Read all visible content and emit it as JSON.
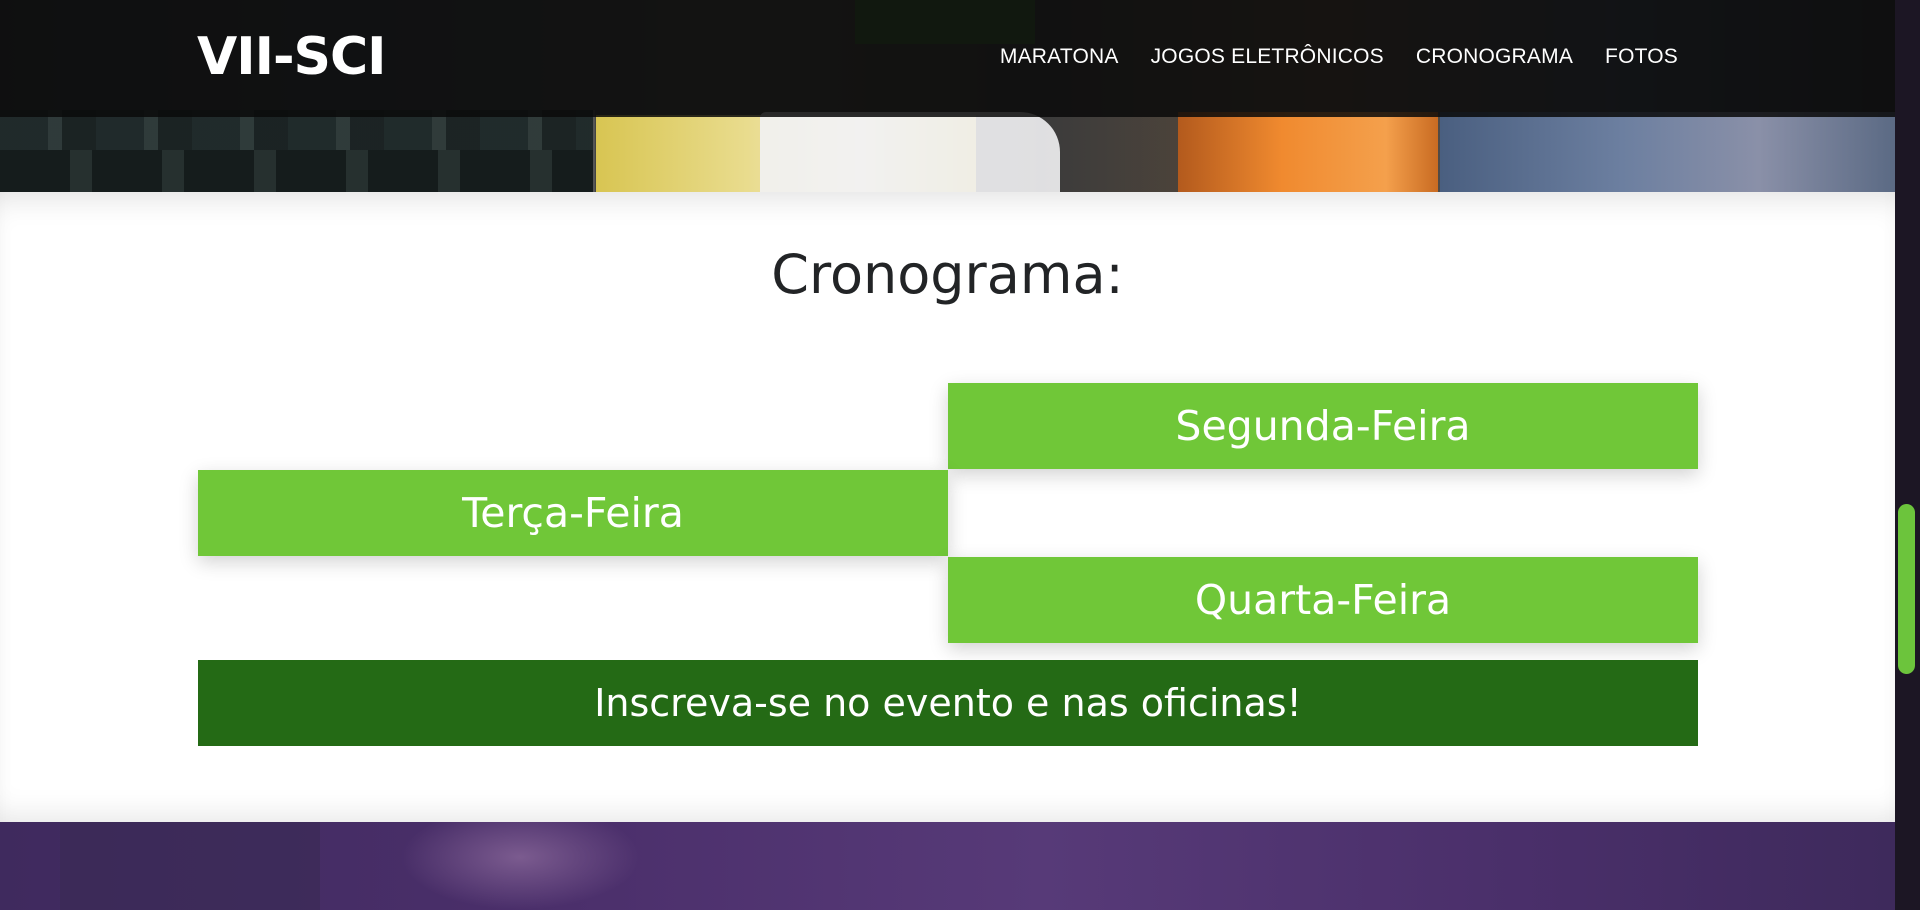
{
  "header": {
    "logo": "VII-SCI",
    "nav": [
      {
        "label": "MARATONA"
      },
      {
        "label": "JOGOS ELETRÔNICOS"
      },
      {
        "label": "CRONOGRAMA"
      },
      {
        "label": "FOTOS"
      }
    ]
  },
  "schedule": {
    "title": "Cronograma:",
    "days": [
      {
        "label": "Segunda-Feira"
      },
      {
        "label": "Terça-Feira"
      },
      {
        "label": "Quarta-Feira"
      }
    ],
    "signup_label": "Inscreva-se no evento e nas oficinas!"
  },
  "colors": {
    "day_green": "#70c738",
    "signup_green": "#246a15",
    "scroll_thumb": "#6cc43c",
    "bottom_purple": "#4b2f6b"
  }
}
